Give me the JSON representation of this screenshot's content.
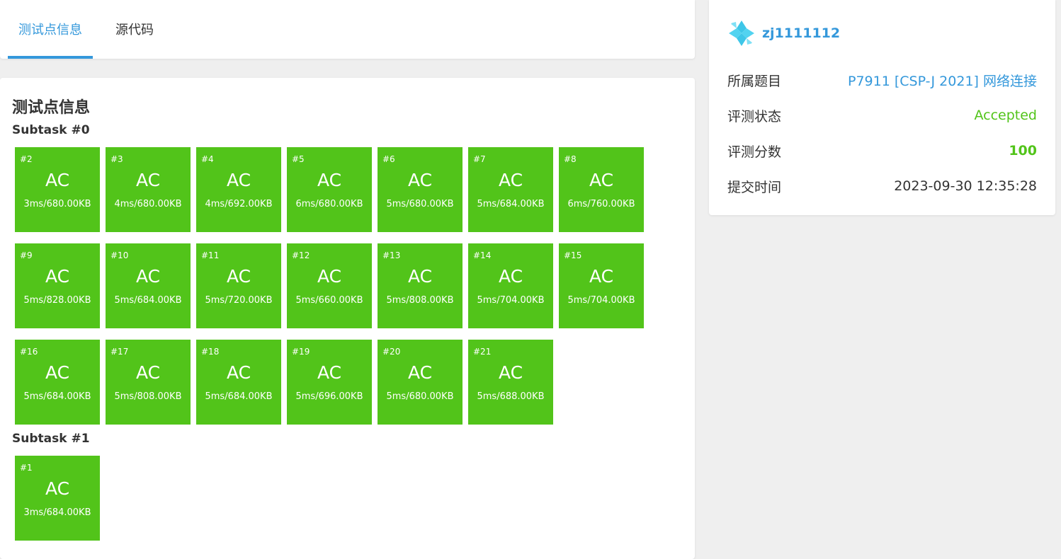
{
  "tabs": [
    {
      "label": "测试点信息",
      "active": true
    },
    {
      "label": "源代码",
      "active": false
    }
  ],
  "main": {
    "title": "测试点信息",
    "subtasks": [
      {
        "title": "Subtask #0",
        "cases": [
          {
            "id": "#2",
            "status": "AC",
            "meta": "3ms/680.00KB"
          },
          {
            "id": "#3",
            "status": "AC",
            "meta": "4ms/680.00KB"
          },
          {
            "id": "#4",
            "status": "AC",
            "meta": "4ms/692.00KB"
          },
          {
            "id": "#5",
            "status": "AC",
            "meta": "6ms/680.00KB"
          },
          {
            "id": "#6",
            "status": "AC",
            "meta": "5ms/680.00KB"
          },
          {
            "id": "#7",
            "status": "AC",
            "meta": "5ms/684.00KB"
          },
          {
            "id": "#8",
            "status": "AC",
            "meta": "6ms/760.00KB"
          },
          {
            "id": "#9",
            "status": "AC",
            "meta": "5ms/828.00KB"
          },
          {
            "id": "#10",
            "status": "AC",
            "meta": "5ms/684.00KB"
          },
          {
            "id": "#11",
            "status": "AC",
            "meta": "5ms/720.00KB"
          },
          {
            "id": "#12",
            "status": "AC",
            "meta": "5ms/660.00KB"
          },
          {
            "id": "#13",
            "status": "AC",
            "meta": "5ms/808.00KB"
          },
          {
            "id": "#14",
            "status": "AC",
            "meta": "5ms/704.00KB"
          },
          {
            "id": "#15",
            "status": "AC",
            "meta": "5ms/704.00KB"
          },
          {
            "id": "#16",
            "status": "AC",
            "meta": "5ms/684.00KB"
          },
          {
            "id": "#17",
            "status": "AC",
            "meta": "5ms/808.00KB"
          },
          {
            "id": "#18",
            "status": "AC",
            "meta": "5ms/684.00KB"
          },
          {
            "id": "#19",
            "status": "AC",
            "meta": "5ms/696.00KB"
          },
          {
            "id": "#20",
            "status": "AC",
            "meta": "5ms/680.00KB"
          },
          {
            "id": "#21",
            "status": "AC",
            "meta": "5ms/688.00KB"
          }
        ]
      },
      {
        "title": "Subtask #1",
        "cases": [
          {
            "id": "#1",
            "status": "AC",
            "meta": "3ms/684.00KB"
          }
        ]
      }
    ]
  },
  "side": {
    "username": "zj1111112",
    "avatar_icon": "user-avatar-icon",
    "rows": [
      {
        "label": "所属题目",
        "value": "P7911 [CSP-J 2021] 网络连接"
      },
      {
        "label": "评测状态",
        "value": "Accepted"
      },
      {
        "label": "评测分数",
        "value": "100"
      },
      {
        "label": "提交时间",
        "value": "2023-09-30 12:35:28"
      }
    ]
  },
  "colors": {
    "accent": "#3498db",
    "accepted": "#52c41a",
    "background": "#efefef"
  }
}
